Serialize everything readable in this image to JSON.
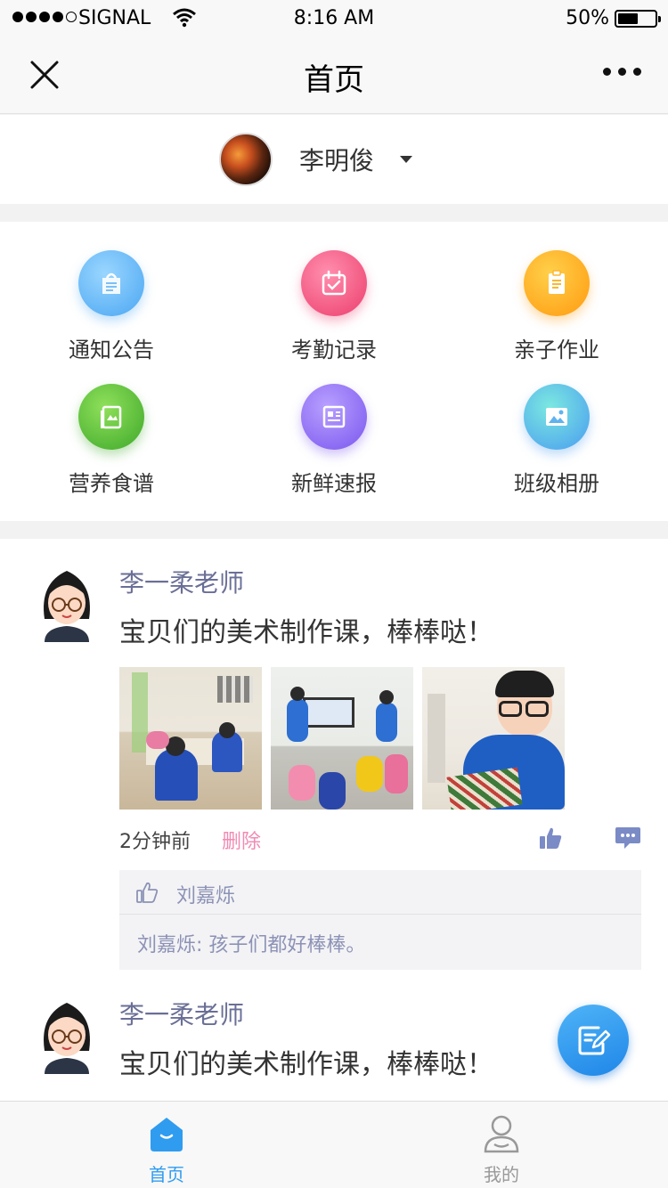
{
  "status_bar": {
    "carrier": "SIGNAL",
    "time": "8:16 AM",
    "battery_percent": "50%",
    "battery_level": 0.5
  },
  "nav": {
    "title": "首页",
    "close_icon": "close-icon",
    "more_icon": "more-icon"
  },
  "child": {
    "name": "李明俊"
  },
  "features": [
    {
      "label": "通知公告",
      "icon": "notice-icon",
      "color": "#5fb6f5"
    },
    {
      "label": "考勤记录",
      "icon": "attendance-icon",
      "color": "#f0517d"
    },
    {
      "label": "亲子作业",
      "icon": "homework-icon",
      "color": "#ffa11a"
    },
    {
      "label": "营养食谱",
      "icon": "recipe-icon",
      "color": "#5bbf33"
    },
    {
      "label": "新鲜速报",
      "icon": "news-icon",
      "color": "#8a6cf0"
    },
    {
      "label": "班级相册",
      "icon": "album-icon",
      "color": "#3fc5cc"
    }
  ],
  "posts": [
    {
      "author": "李一柔老师",
      "text": "宝贝们的美术制作课，棒棒哒！",
      "time": "2分钟前",
      "delete_label": "删除",
      "like_name": "刘嘉烁",
      "comment": "刘嘉烁: 孩子们都好棒棒。"
    },
    {
      "author": "李一柔老师",
      "text": "宝贝们的美术制作课，棒棒哒！"
    }
  ],
  "tabs": [
    {
      "label": "首页",
      "active": true
    },
    {
      "label": "我的",
      "active": false
    }
  ],
  "colors": {
    "accent": "#2f9cf0",
    "author": "#6a6f96",
    "delete": "#f08bb3",
    "comment_text": "#8c92b6"
  }
}
